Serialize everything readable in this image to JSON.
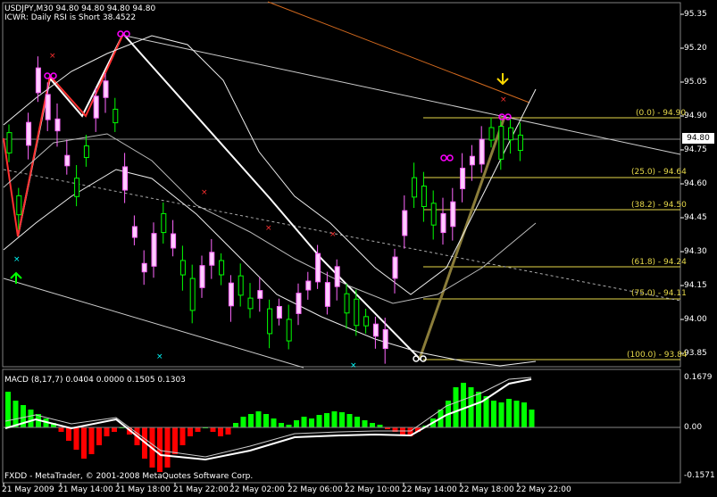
{
  "header": {
    "symbol_line": "USDJPY,M30  94.80 94.80 94.80 94.80",
    "indicator_line": "ICWR: Daily RSI is Short 38.4522"
  },
  "current_price": "94.80",
  "price_axis": [
    "95.35",
    "95.20",
    "95.05",
    "94.90",
    "94.75",
    "94.60",
    "94.45",
    "94.30",
    "94.15",
    "94.00",
    "93.85"
  ],
  "fib_levels": [
    {
      "label": "(0.0) - 94.90"
    },
    {
      "label": "(25.0) - 94.64"
    },
    {
      "label": "(38.2) - 94.50"
    },
    {
      "label": "(61.8) - 94.24"
    },
    {
      "label": "(75.0) - 94.11"
    },
    {
      "label": "(100.0) - 93.84"
    }
  ],
  "macd": {
    "title": "MACD (8,17,7) 0.0404 0.0000 0.1505 0.1303",
    "axis": [
      "0.1679",
      "0.00",
      "-0.1571"
    ]
  },
  "footer": "FXDD - MetaTrader, © 2001-2008 MetaQuotes Software Corp.",
  "time_axis": [
    "21 May 2009",
    "21 May 14:00",
    "21 May 18:00",
    "21 May 22:00",
    "22 May 02:00",
    "22 May 06:00",
    "22 May 10:00",
    "22 May 14:00",
    "22 May 18:00",
    "22 May 22:00"
  ],
  "colors": {
    "background": "#000000",
    "bull_candle": "#00ff00",
    "bear_candle": "#ff66ff",
    "fib": "#e6d84a",
    "trend_white": "#ffffff",
    "trend_orange": "#d2691e",
    "macd_up": "#00ff00",
    "macd_down": "#ff0000"
  }
}
